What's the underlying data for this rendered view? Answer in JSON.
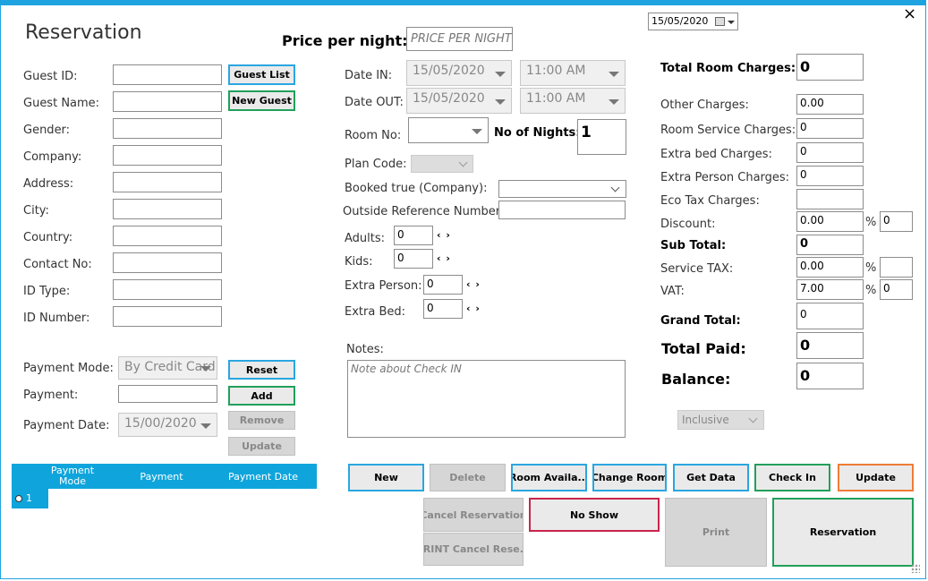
{
  "title": "Reservation",
  "close_glyph": "×",
  "top_date": "15/05/2020",
  "price": {
    "label": "Price per night:",
    "placeholder": "PRICE PER NIGHT"
  },
  "guest": {
    "fields": [
      {
        "name": "guest-id",
        "label": "Guest ID:"
      },
      {
        "name": "guest-name",
        "label": "Guest Name:"
      },
      {
        "name": "gender",
        "label": "Gender:"
      },
      {
        "name": "company",
        "label": "Company:"
      },
      {
        "name": "address",
        "label": "Address:"
      },
      {
        "name": "city",
        "label": "City:"
      },
      {
        "name": "country",
        "label": "Country:"
      },
      {
        "name": "contact-no",
        "label": "Contact No:"
      },
      {
        "name": "id-type",
        "label": "ID Type:"
      },
      {
        "name": "id-number",
        "label": "ID Number:"
      }
    ],
    "guest_list_btn": "Guest List",
    "new_guest_btn": "New Guest"
  },
  "payment": {
    "mode_label": "Payment Mode:",
    "mode_value": "By Credit Card",
    "payment_label": "Payment:",
    "date_label": "Payment Date:",
    "date_value": "15/00/2020",
    "reset_btn": "Reset",
    "add_btn": "Add",
    "remove_btn": "Remove",
    "update_btn": "Update",
    "grid_headers": [
      "Payment Mode",
      "Payment",
      "Payment Date"
    ],
    "grid_rows": [
      {
        "id": "1"
      }
    ]
  },
  "stay": {
    "date_in_label": "Date IN:",
    "date_in": "15/05/2020",
    "time_in": "11:00 AM",
    "date_out_label": "Date OUT:",
    "date_out": "15/05/2020",
    "time_out": "11:00 AM",
    "room_no_label": "Room No:",
    "nights_label": "No of Nights:",
    "nights": "1",
    "plan_code_label": "Plan Code:",
    "booked_label": "Booked true (Company):",
    "outside_ref_label": "Outside Reference Number:",
    "adults_label": "Adults:",
    "adults": "0",
    "kids_label": "Kids:",
    "kids": "0",
    "extra_person_label": "Extra Person:",
    "extra_person": "0",
    "extra_bed_label": "Extra Bed:",
    "extra_bed": "0",
    "spin_glyph": "‹ ›",
    "notes_label": "Notes:",
    "notes_placeholder": "Note about Check IN"
  },
  "charges": {
    "total_room_label": "Total Room Charges:",
    "total_room": "0",
    "other_label": "Other Charges:",
    "other": "0.00",
    "room_service_label": "Room Service Charges:",
    "room_service": "0",
    "extra_bed_label": "Extra bed Charges:",
    "extra_bed": "0",
    "extra_person_label": "Extra Person Charges:",
    "extra_person": "0",
    "eco_tax_label": "Eco Tax Charges:",
    "eco_tax": "",
    "discount_label": "Discount:",
    "discount": "0.00",
    "discount_pct": "0",
    "subtotal_label": "Sub Total:",
    "subtotal": "0",
    "service_tax_label": "Service TAX:",
    "service_tax": "0.00",
    "service_tax_pct": "",
    "vat_label": "VAT:",
    "vat": "7.00",
    "vat_pct": "0",
    "pct_sign": "%",
    "grand_total_label": "Grand Total:",
    "grand_total": "0",
    "total_paid_label": "Total Paid:",
    "total_paid": "0",
    "balance_label": "Balance:",
    "balance": "0",
    "tax_mode": "Inclusive"
  },
  "actions": {
    "new": "New",
    "delete": "Delete",
    "room_availability": "Room Availa...",
    "change_room": "Change Room",
    "get_data": "Get Data",
    "check_in": "Check In",
    "update": "Update",
    "cancel_reservation": "Cancel Reservation",
    "no_show": "No Show",
    "print": "Print",
    "reservation": "Reservation",
    "print_cancel": "PRINT Cancel Rese..."
  },
  "colors": {
    "accent": "#1fa3e0",
    "green": "#21a05a",
    "orange": "#ee7d35",
    "red": "#c8264e",
    "grid_header": "#0fa5dc"
  }
}
